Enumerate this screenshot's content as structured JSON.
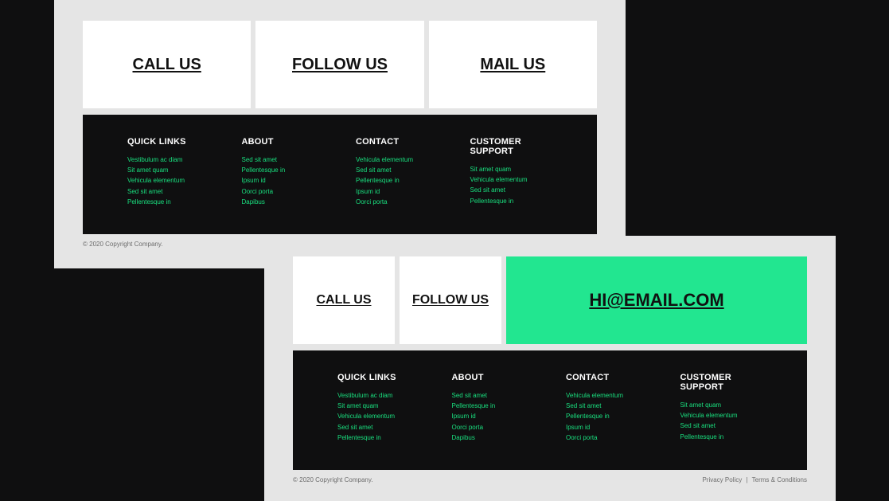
{
  "a": {
    "cards": [
      {
        "title": "CALL US"
      },
      {
        "title": "FOLLOW US"
      },
      {
        "title": "MAIL US"
      }
    ],
    "footer": {
      "cols": [
        {
          "heading": "QUICK LINKS",
          "links": [
            "Vestibulum ac diam",
            "Sit amet quam",
            "Vehicula elementum",
            "Sed sit amet",
            "Pellentesque in"
          ]
        },
        {
          "heading": "ABOUT",
          "links": [
            "Sed sit amet",
            "Pellentesque in",
            "Ipsum id",
            "Oorci porta",
            "Dapibus"
          ]
        },
        {
          "heading": "CONTACT",
          "links": [
            "Vehicula elementum",
            "Sed sit amet",
            "Pellentesque in",
            "Ipsum id",
            "Oorci porta"
          ]
        },
        {
          "heading": "CUSTOMER SUPPORT",
          "links": [
            "Sit amet quam",
            "Vehicula elementum",
            "Sed sit amet",
            "Pellentesque in"
          ]
        }
      ]
    },
    "copyright": "© 2020 Copyright Company."
  },
  "b": {
    "cards": [
      {
        "title": "CALL US"
      },
      {
        "title": "FOLLOW US"
      },
      {
        "title": "HI@EMAIL.COM"
      }
    ],
    "footer": {
      "cols": [
        {
          "heading": "QUICK LINKS",
          "links": [
            "Vestibulum ac diam",
            "Sit amet quam",
            "Vehicula elementum",
            "Sed sit amet",
            "Pellentesque in"
          ]
        },
        {
          "heading": "ABOUT",
          "links": [
            "Sed sit amet",
            "Pellentesque in",
            "Ipsum id",
            "Oorci porta",
            "Dapibus"
          ]
        },
        {
          "heading": "CONTACT",
          "links": [
            "Vehicula elementum",
            "Sed sit amet",
            "Pellentesque in",
            "Ipsum id",
            "Oorci porta"
          ]
        },
        {
          "heading": "CUSTOMER SUPPORT",
          "links": [
            "Sit amet quam",
            "Vehicula elementum",
            "Sed sit amet",
            "Pellentesque in"
          ]
        }
      ]
    },
    "copyright": "© 2020 Copyright Company.",
    "legal": {
      "privacy": "Privacy Policy",
      "terms": "Terms & Conditions"
    }
  }
}
